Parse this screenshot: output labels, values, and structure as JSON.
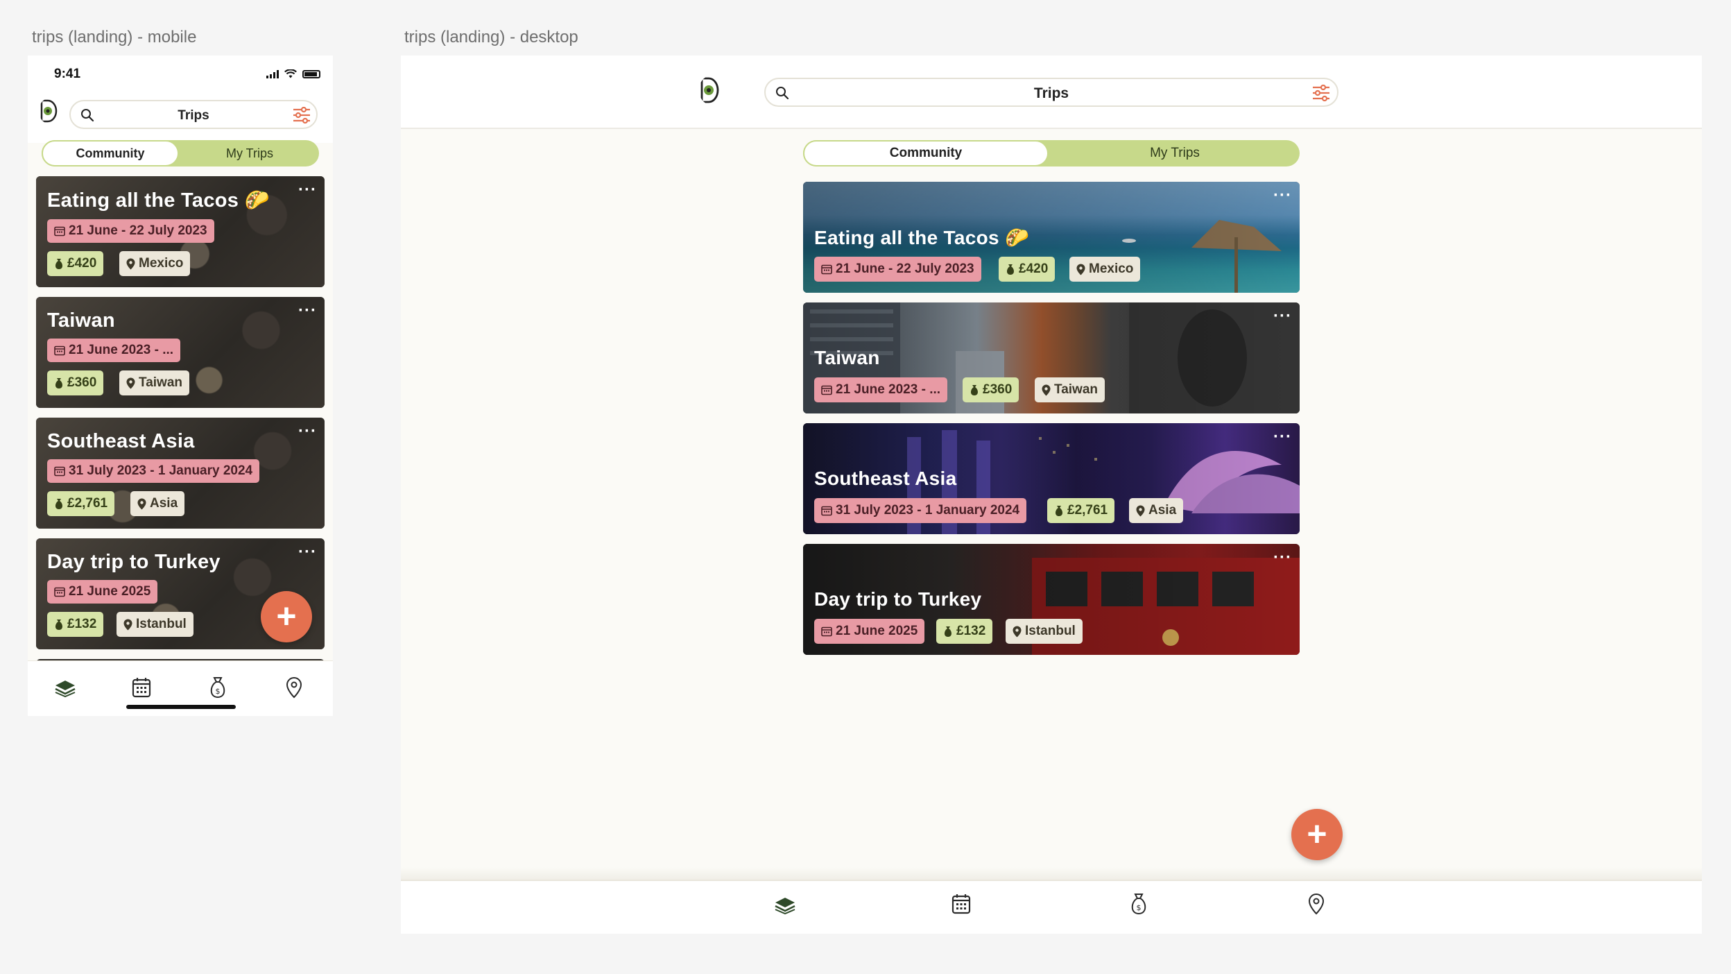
{
  "labels": {
    "mobile": "trips (landing) - mobile",
    "desktop": "trips (landing) - desktop"
  },
  "status": {
    "time": "9:41"
  },
  "search": {
    "title": "Trips"
  },
  "tabs": {
    "community": "Community",
    "my_trips": "My Trips",
    "active": "community"
  },
  "more_label": "···",
  "fab_label": "+",
  "trips": [
    {
      "title": "Eating all the Tacos 🌮",
      "dates": "21 June - 22 July 2023",
      "dates_short": "21 June - 22 July 2023",
      "cost": "£420",
      "location": "Mexico"
    },
    {
      "title": "Taiwan",
      "dates": "21 June 2023 - ...",
      "dates_short": "21 June 2023 - ...",
      "cost": "£360",
      "location": "Taiwan"
    },
    {
      "title": "Southeast Asia",
      "dates": "31 July 2023 - 1 January 2024",
      "dates_short": "31 July 2023 - 1 January 2024",
      "cost": "£2,761",
      "location": "Asia"
    },
    {
      "title": "Day trip to Turkey",
      "dates": "21 June 2025",
      "dates_short": "21 June 2025",
      "cost": "£132",
      "location": "Istanbul"
    }
  ],
  "nav": [
    {
      "icon": "layers-icon"
    },
    {
      "icon": "calendar-icon"
    },
    {
      "icon": "money-bag-icon"
    },
    {
      "icon": "location-pin-icon"
    }
  ],
  "colors": {
    "accent": "#e4704f",
    "segment": "#c7d98a",
    "chip_date": "#e89aa4",
    "chip_cost": "#d7e4a8",
    "chip_location": "#ece7da",
    "background": "#fbfaf6"
  }
}
